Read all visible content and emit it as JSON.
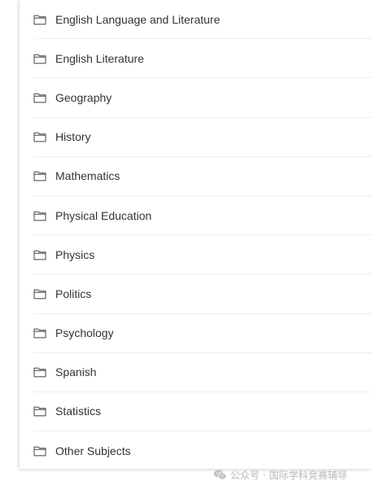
{
  "subjects": {
    "items": [
      {
        "label": "English Language and Literature",
        "icon": "folder-icon"
      },
      {
        "label": "English Literature",
        "icon": "folder-icon"
      },
      {
        "label": "Geography",
        "icon": "folder-icon"
      },
      {
        "label": "History",
        "icon": "folder-icon"
      },
      {
        "label": "Mathematics",
        "icon": "folder-icon"
      },
      {
        "label": "Physical Education",
        "icon": "folder-icon"
      },
      {
        "label": "Physics",
        "icon": "folder-icon"
      },
      {
        "label": "Politics",
        "icon": "folder-icon"
      },
      {
        "label": "Psychology",
        "icon": "folder-icon"
      },
      {
        "label": "Spanish",
        "icon": "folder-icon"
      },
      {
        "label": "Statistics",
        "icon": "folder-icon"
      },
      {
        "label": "Other Subjects",
        "icon": "folder-icon"
      }
    ]
  },
  "watermark": {
    "text": "公众号 · 国际学科竞赛辅导",
    "icon": "wechat-icon"
  },
  "colors": {
    "text": "#333333",
    "icon": "#555555",
    "divider": "#eeeeee",
    "watermark": "#b7b7b7"
  }
}
